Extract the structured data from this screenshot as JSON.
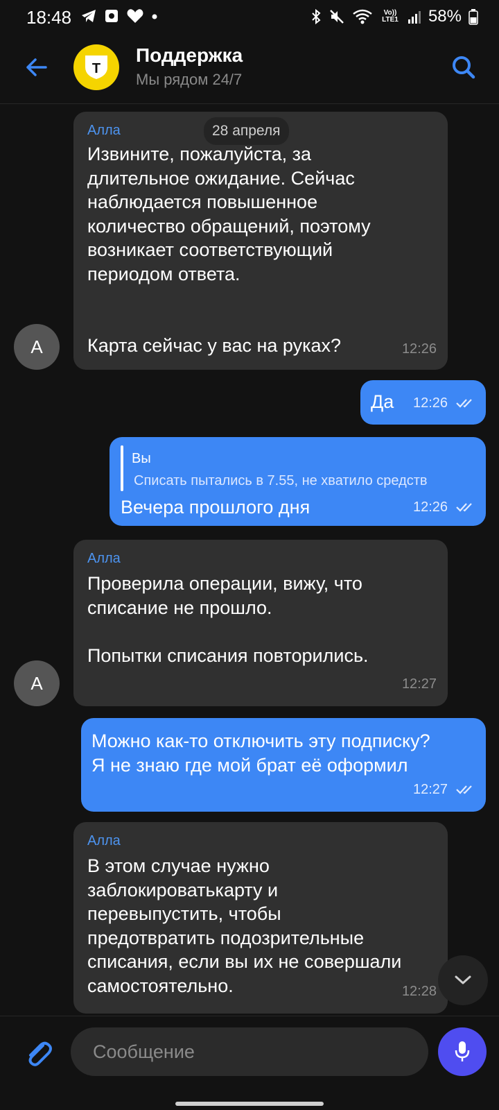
{
  "status_bar": {
    "time": "18:48",
    "battery": "58%",
    "network": "Vo)) LTE1"
  },
  "header": {
    "title": "Поддержка",
    "subtitle": "Мы рядом 24/7",
    "logo_letter": "Т"
  },
  "chat": {
    "date_chip": "28 апреля",
    "messages": [
      {
        "sender": "Алла",
        "text": "Извините, пожалуйста, за\nдлительное ожидание. Сейчас\nнаблюдается повышенное\nколичество обращений, поэтому\nвозникает соответствующий\nпериодом ответа.\n\n\nКарта сейчас у вас на руках?",
        "time": "12:26",
        "avatar_letter": "А"
      },
      {
        "text": "Да",
        "time": "12:26"
      },
      {
        "reply_name": "Вы",
        "reply_text": "Списать пытались в 7.55, не хватило средств",
        "text": "Вечера прошлого дня",
        "time": "12:26"
      },
      {
        "sender": "Алла",
        "text": "Проверила операции, вижу, что\nсписание не прошло.\n\nПопытки списания повторились.",
        "time": "12:27",
        "avatar_letter": "А"
      },
      {
        "text": "Можно как-то отключить эту подписку?\nЯ не знаю где мой брат её оформил",
        "time": "12:27"
      },
      {
        "sender": "Алла",
        "text": "В этом случае нужно\nзаблокироватькарту и\nперевыпустить, чтобы\nпредотвратить подозрительные\nсписания, если вы их не совершали\nсамостоятельно.",
        "time": "12:28"
      }
    ]
  },
  "composer": {
    "placeholder": "Сообщение"
  }
}
